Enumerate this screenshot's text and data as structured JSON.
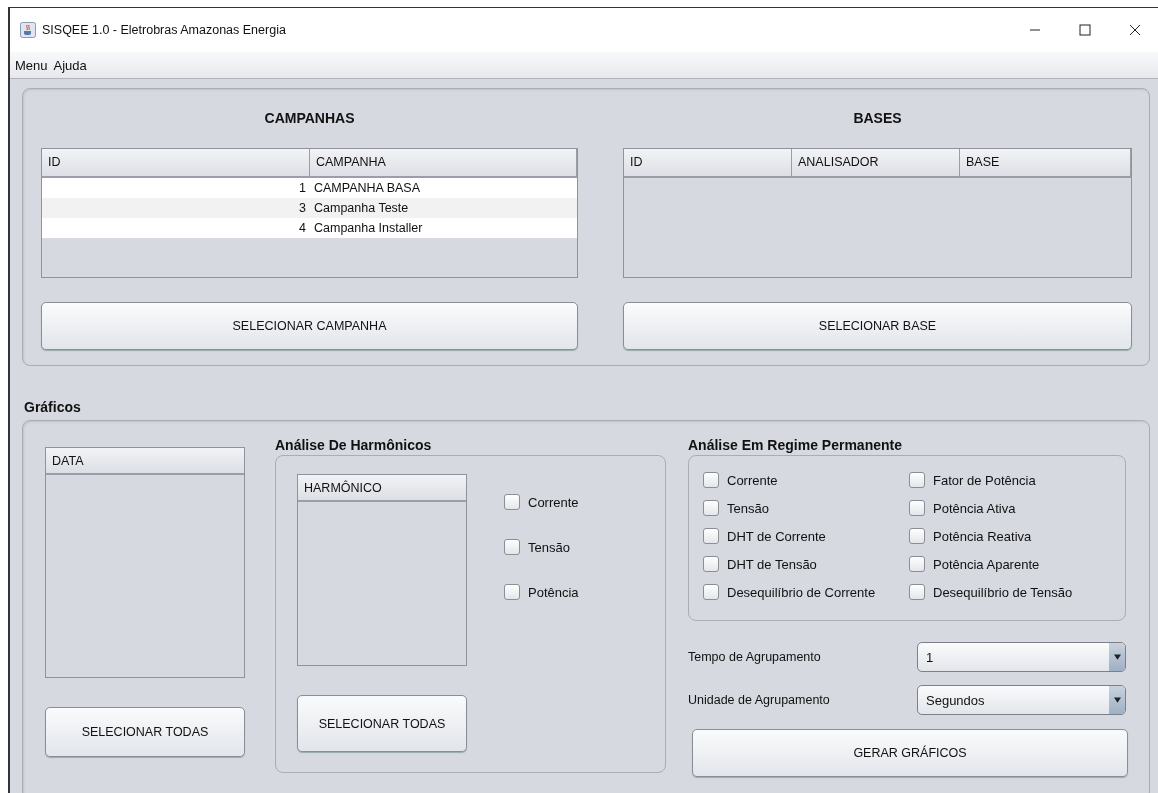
{
  "window": {
    "title": "SISQEE 1.0 - Eletrobras Amazonas Energia"
  },
  "menu": [
    "Menu",
    "Ajuda"
  ],
  "campanhas": {
    "title": "CAMPANHAS",
    "columns": [
      "ID",
      "CAMPANHA"
    ],
    "rows": [
      {
        "id": "1",
        "name": "CAMPANHA BASA"
      },
      {
        "id": "3",
        "name": "Campanha Teste"
      },
      {
        "id": "4",
        "name": "Campanha Installer"
      }
    ],
    "button": "SELECIONAR CAMPANHA"
  },
  "bases": {
    "title": "BASES",
    "columns": [
      "ID",
      "ANALISADOR",
      "BASE"
    ],
    "button": "SELECIONAR BASE"
  },
  "graficos": {
    "title": "Gráficos",
    "data_list": {
      "column": "DATA",
      "button": "SELECIONAR TODAS"
    },
    "harmonicos": {
      "title": "Análise De Harmônicos",
      "column": "HARMÔNICO",
      "button": "SELECIONAR TODAS",
      "options": [
        {
          "label": "Corrente",
          "checked": false
        },
        {
          "label": "Tensão",
          "checked": false
        },
        {
          "label": "Potência",
          "checked": false
        }
      ]
    },
    "regime": {
      "title": "Análise Em Regime Permanente",
      "options": [
        {
          "label": "Corrente",
          "checked": false
        },
        {
          "label": "Fator de Potência",
          "checked": false
        },
        {
          "label": "Tensão",
          "checked": false
        },
        {
          "label": "Potência Ativa",
          "checked": false
        },
        {
          "label": "DHT de Corrente",
          "checked": false
        },
        {
          "label": "Potência Reativa",
          "checked": false
        },
        {
          "label": "DHT de Tensão",
          "checked": false
        },
        {
          "label": "Potência Aparente",
          "checked": false
        },
        {
          "label": "Desequilíbrio de Corrente",
          "checked": false
        },
        {
          "label": "Desequilíbrio de Tensão",
          "checked": false
        }
      ]
    },
    "tempo": {
      "label": "Tempo de Agrupamento",
      "value": "1"
    },
    "unidade": {
      "label": "Unidade de Agrupamento",
      "value": "Segundos"
    },
    "button": "GERAR GRÁFICOS"
  }
}
